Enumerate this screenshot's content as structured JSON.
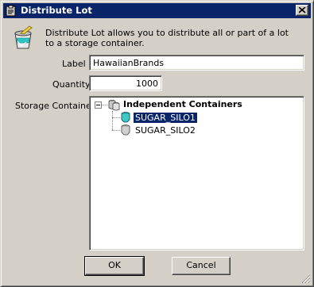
{
  "window": {
    "title": "Distribute Lot",
    "icon": "clipboard-icon"
  },
  "header": {
    "icon": "bucket-icon",
    "description": "Distribute Lot allows you to distribute all or part of a lot to a storage container."
  },
  "form": {
    "label_caption": "Label",
    "label_value": "HawaiianBrands",
    "quantity_caption": "Quantity",
    "quantity_value": "1000",
    "storage_caption": "Storage Container"
  },
  "tree": {
    "root": "Independent Containers",
    "children": [
      "SUGAR_SILO1",
      "SUGAR_SILO2"
    ],
    "selected": "SUGAR_SILO1"
  },
  "buttons": {
    "ok": "OK",
    "cancel": "Cancel"
  },
  "colors": {
    "titlebar": "#0a246a",
    "selection": "#0a246a",
    "face": "#d4d0c8"
  }
}
